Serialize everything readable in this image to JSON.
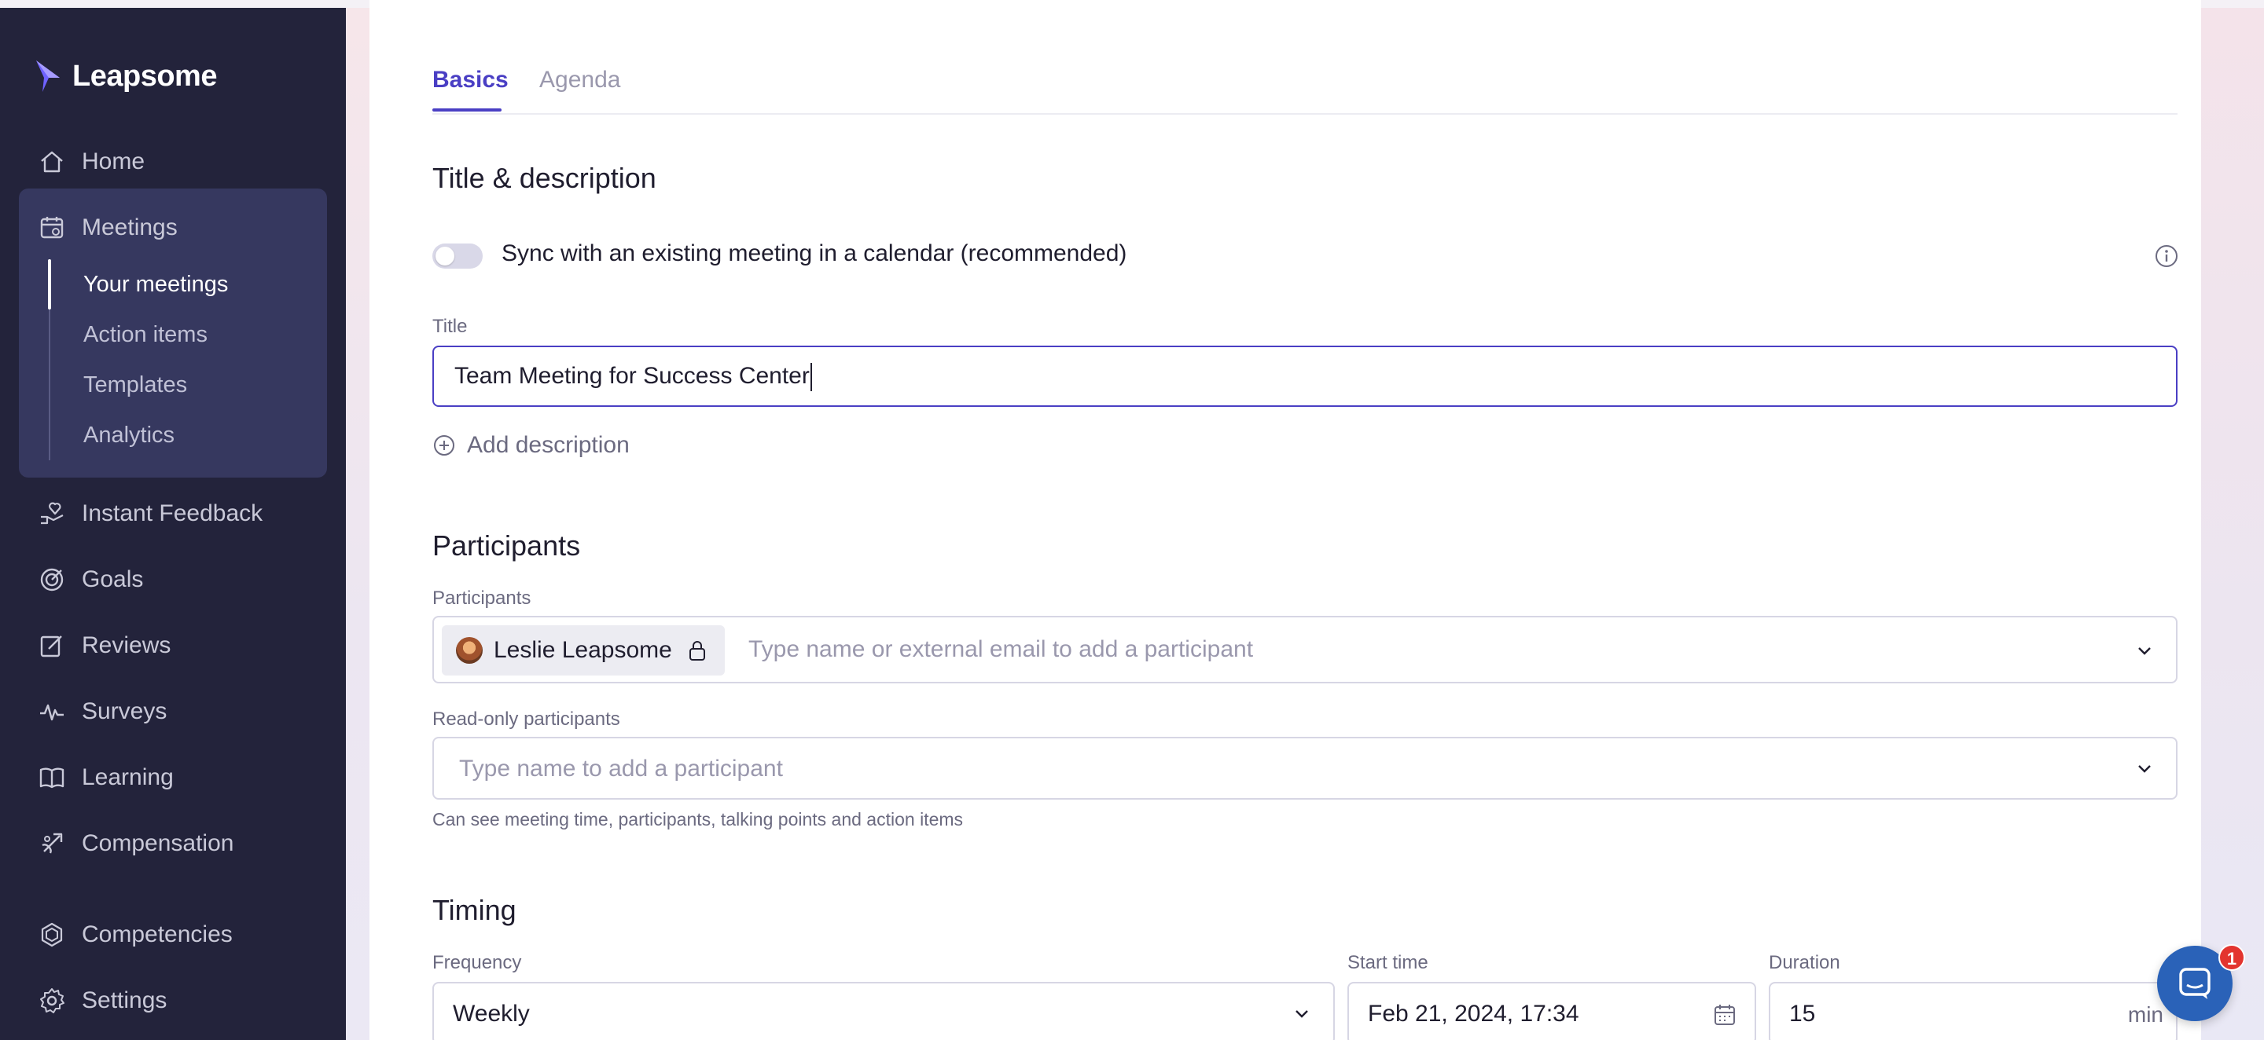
{
  "brand": {
    "name": "Leapsome"
  },
  "sidebar": {
    "items": [
      {
        "label": "Home",
        "icon": "home-icon"
      },
      {
        "label": "Meetings",
        "icon": "meetings-icon"
      },
      {
        "label": "Instant Feedback",
        "icon": "feedback-icon"
      },
      {
        "label": "Goals",
        "icon": "goals-icon"
      },
      {
        "label": "Reviews",
        "icon": "reviews-icon"
      },
      {
        "label": "Surveys",
        "icon": "surveys-icon"
      },
      {
        "label": "Learning",
        "icon": "learning-icon"
      },
      {
        "label": "Compensation",
        "icon": "compensation-icon"
      },
      {
        "label": "Competencies",
        "icon": "competencies-icon"
      },
      {
        "label": "Settings",
        "icon": "settings-icon"
      }
    ],
    "meetings_sub": [
      {
        "label": "Your meetings",
        "active": true
      },
      {
        "label": "Action items"
      },
      {
        "label": "Templates"
      },
      {
        "label": "Analytics"
      }
    ]
  },
  "tabs": {
    "basics": "Basics",
    "agenda": "Agenda"
  },
  "title_section": {
    "heading": "Title & description",
    "sync_label": "Sync with an existing meeting in a calendar (recommended)",
    "sync_enabled": false,
    "title_label": "Title",
    "title_value": "Team Meeting for Success Center",
    "add_description": "Add description"
  },
  "participants_section": {
    "heading": "Participants",
    "participants_label": "Participants",
    "participant_chip": "Leslie Leapsome",
    "participants_placeholder": "Type name or external email to add a participant",
    "readonly_label": "Read-only participants",
    "readonly_placeholder": "Type name to add a participant",
    "readonly_helper": "Can see meeting time, participants, talking points and action items"
  },
  "timing_section": {
    "heading": "Timing",
    "frequency_label": "Frequency",
    "frequency_value": "Weekly",
    "start_label": "Start time",
    "start_value": "Feb 21, 2024, 17:34",
    "duration_label": "Duration",
    "duration_value": "15",
    "duration_unit": "min"
  },
  "chat": {
    "badge_count": "1"
  },
  "colors": {
    "accent": "#4a3fc4",
    "sidebar_bg": "#23233b",
    "sidebar_active_group": "#36385f",
    "badge": "#e3342f",
    "chat": "#2a62b8"
  }
}
